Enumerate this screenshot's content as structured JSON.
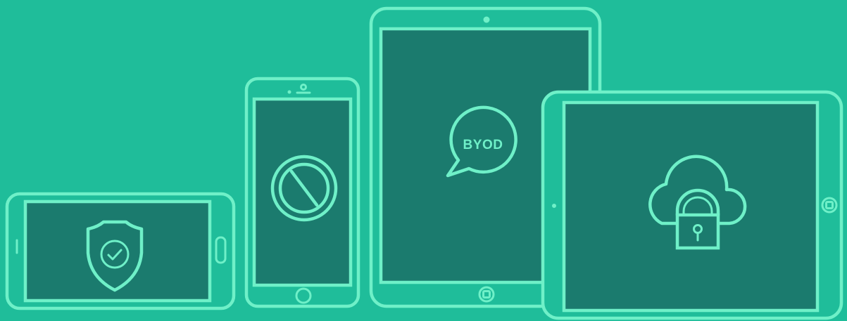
{
  "illustration": {
    "colors": {
      "background": "#1fbd9a",
      "outline": "#6ff0c8",
      "screen": "#1b7b6e"
    },
    "devices": [
      {
        "kind": "phone-landscape",
        "icon": "shield-check-icon"
      },
      {
        "kind": "phone-portrait",
        "icon": "prohibited-icon"
      },
      {
        "kind": "tablet-portrait",
        "icon": "speech-bubble-icon",
        "label": "BYOD"
      },
      {
        "kind": "tablet-landscape",
        "icon": "cloud-lock-icon"
      }
    ]
  }
}
